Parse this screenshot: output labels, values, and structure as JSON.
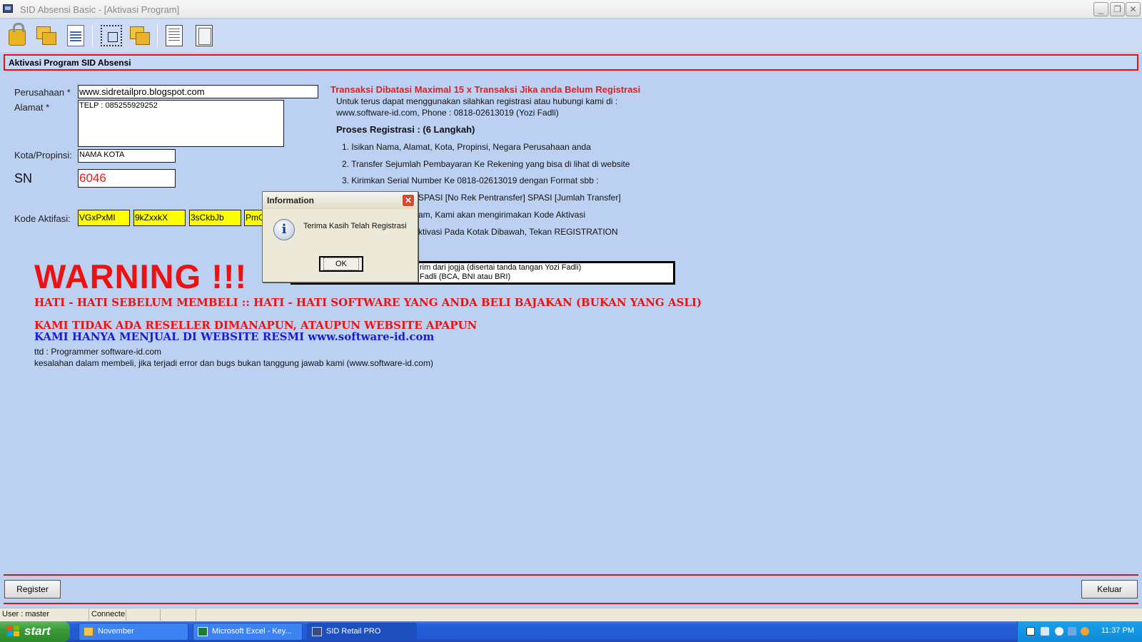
{
  "window": {
    "title": "SID Absensi Basic - [Aktivasi Program]",
    "minimize_glyph": "_",
    "restore_glyph": "❐",
    "close_glyph": "✕"
  },
  "toolbar": {
    "icons": [
      "lock-icon",
      "stacked-folders-icon",
      "document-icon",
      "grid-select-icon",
      "stacked-folders-icon",
      "page-icon",
      "frame-icon"
    ]
  },
  "section": {
    "title": "Aktivasi Program SID Absensi"
  },
  "form": {
    "perusahaan_label": "Perusahaan *",
    "perusahaan_value": "www.sidretailpro.blogspot.com",
    "alamat_label": "Alamat *",
    "alamat_value": "TELP : 085255929252",
    "kota_label": "Kota/Propinsi:",
    "kota_value": "NAMA KOTA",
    "sn_label": "SN",
    "sn_value": "6046",
    "kode_label": "Kode Aktifasi:",
    "kode_values": [
      "VGxPxMI",
      "9kZxxkX",
      "3sCkbJb",
      "PmC"
    ]
  },
  "info": {
    "red_heading": "Transaksi Dibatasi Maximal 15 x Transaksi Jika anda Belum Registrasi",
    "line1": "Untuk terus dapat menggunakan silahkan registrasi atau hubungi kami di :",
    "line2": "www.software-id.com, Phone : 0818-02613019 (Yozi Fadli)",
    "process_heading": "Proses Registrasi : (6 Langkah)",
    "step1": "1. Isikan Nama, Alamat, Kota, Propinsi, Negara Perusahaan anda",
    "step2": "2. Transfer Sejumlah Pembayaran Ke Rekening yang bisa di lihat di website",
    "step3": "3. Kirimkan Serial Number Ke 0818-02613019 dengan Format sbb :",
    "step4_fragment": "SPASI [No Rek Pentransfer] SPASI [Jumlah Transfer]",
    "step5_fragment": "am, Kami akan mengirimakan Kode Aktivasi",
    "step6_fragment": "ktivasi Pada Kotak Dibawah, Tekan REGISTRATION",
    "box_line1": "rim dari jogja (disertai tanda tangan Yozi Fadli)",
    "box_line2": "Fadli (BCA, BNI atau BRI)"
  },
  "warning": {
    "title": "WARNING !!!",
    "line1": "HATI - HATI SEBELUM MEMBELI :: HATI - HATI SOFTWARE YANG ANDA BELI BAJAKAN (BUKAN YANG ASLI)",
    "line2": "KAMI TIDAK ADA RESELLER DIMANAPUN, ATAUPUN WEBSITE APAPUN",
    "line3": "KAMI HANYA MENJUAL DI WEBSITE RESMI www.software-id.com",
    "sig": "ttd : Programmer software-id.com",
    "disclaimer": "kesalahan dalam membeli, jika terjadi error dan bugs bukan tanggung jawab kami (www.software-id.com)"
  },
  "dialog": {
    "title": "Information",
    "close_glyph": "✕",
    "icon_glyph": "i",
    "message": "Terima Kasih Telah Registrasi",
    "ok_label": "OK"
  },
  "buttons": {
    "register": "Register",
    "keluar": "Keluar"
  },
  "status": {
    "user": "User : master",
    "connection": "Connecte"
  },
  "taskbar": {
    "start": "start",
    "tasks": [
      "November",
      "Microsoft Excel - Key...",
      "SID Retail PRO"
    ],
    "clock": "11:37 PM"
  },
  "colors": {
    "background": "#bcd1f2",
    "accent_red": "#e01414",
    "warning_red": "#ee1111",
    "link_blue": "#1a1ad8",
    "activation_yellow": "#ffff00"
  }
}
